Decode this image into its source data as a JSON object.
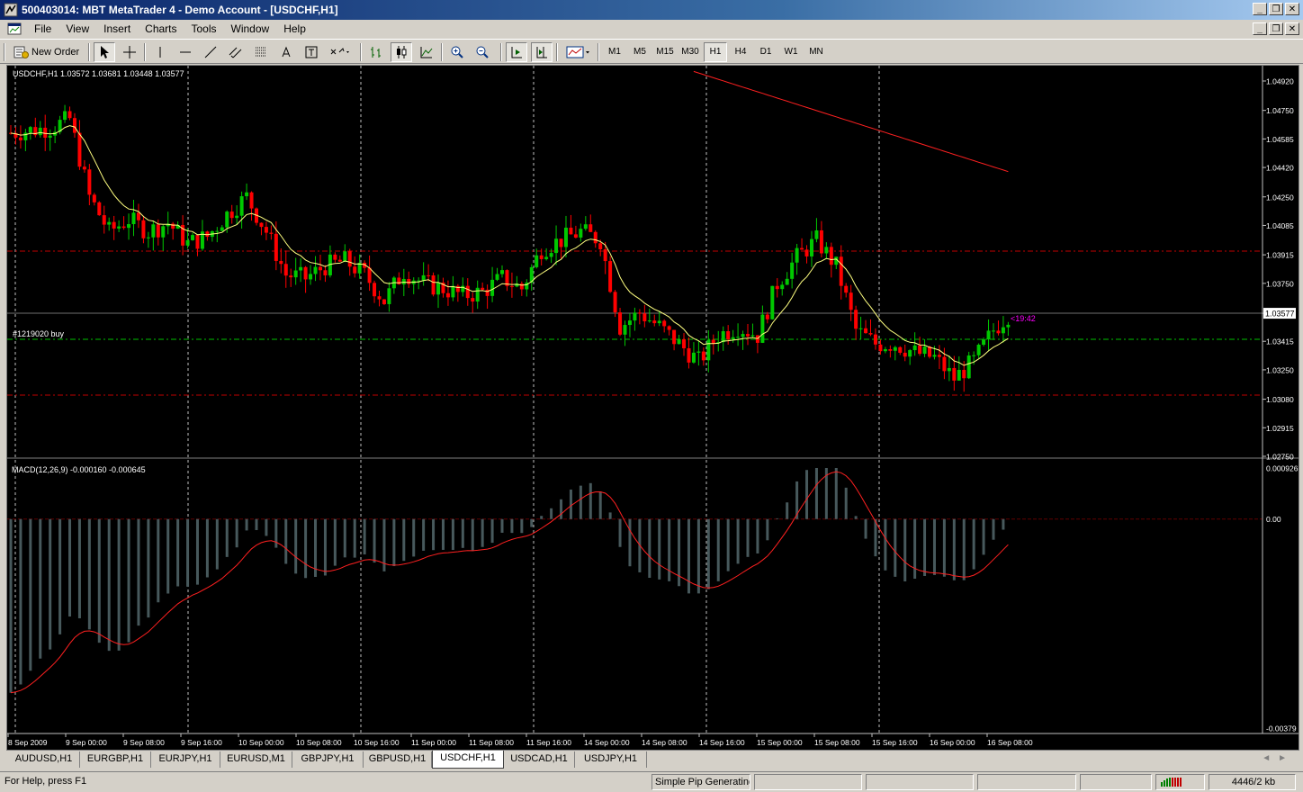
{
  "window": {
    "title": "500403014: MBT MetaTrader 4 - Demo Account - [USDCHF,H1]"
  },
  "menu": {
    "items": [
      "File",
      "View",
      "Insert",
      "Charts",
      "Tools",
      "Window",
      "Help"
    ]
  },
  "toolbar": {
    "new_order_label": "New Order",
    "timeframes": [
      "M1",
      "M5",
      "M15",
      "M30",
      "H1",
      "H4",
      "D1",
      "W1",
      "MN"
    ],
    "active_timeframe": "H1"
  },
  "chart": {
    "info_label": "USDCHF,H1  1.03572 1.03681 1.03448 1.03577",
    "price_labels": [
      "1.04920",
      "1.04750",
      "1.04585",
      "1.04420",
      "1.04250",
      "1.04085",
      "1.03915",
      "1.03750",
      "1.03577",
      "1.03415",
      "1.03250",
      "1.03080",
      "1.02915",
      "1.02750"
    ],
    "current_price": "1.03577",
    "order_label": "#1219020 buy",
    "countdown": "<19:42",
    "macd_label": "MACD(12,26,9) -0.000160 -0.000645",
    "macd_labels": [
      "0.000926",
      "0.00",
      "-0.00379"
    ],
    "time_labels": [
      "8 Sep 2009",
      "9 Sep 00:00",
      "9 Sep 08:00",
      "9 Sep 16:00",
      "10 Sep 00:00",
      "10 Sep 08:00",
      "10 Sep 16:00",
      "11 Sep 00:00",
      "11 Sep 08:00",
      "11 Sep 16:00",
      "14 Sep 00:00",
      "14 Sep 08:00",
      "14 Sep 16:00",
      "15 Sep 00:00",
      "15 Sep 08:00",
      "15 Sep 16:00",
      "16 Sep 00:00",
      "16 Sep 08:00"
    ],
    "colors": {
      "background": "#000000",
      "bull": "#00c800",
      "bear": "#ff0000",
      "ma_fast": "#ffff80",
      "ma_slow": "#ff2020",
      "macd_hist": "#47595c",
      "grid": "#c0c0c0",
      "order_line": "#00c000",
      "level_line": "#c00000",
      "countdown": "#ff00ff"
    }
  },
  "tabs": {
    "items": [
      "AUDUSD,H1",
      "EURGBP,H1",
      "EURJPY,H1",
      "EURUSD,M1",
      "GBPJPY,H1",
      "GBPUSD,H1",
      "USDCHF,H1",
      "USDCAD,H1",
      "USDJPY,H1"
    ],
    "active": "USDCHF,H1"
  },
  "statusbar": {
    "help": "For Help, press F1",
    "profile": "Simple Pip Generating",
    "traffic": "4446/2 kb"
  }
}
